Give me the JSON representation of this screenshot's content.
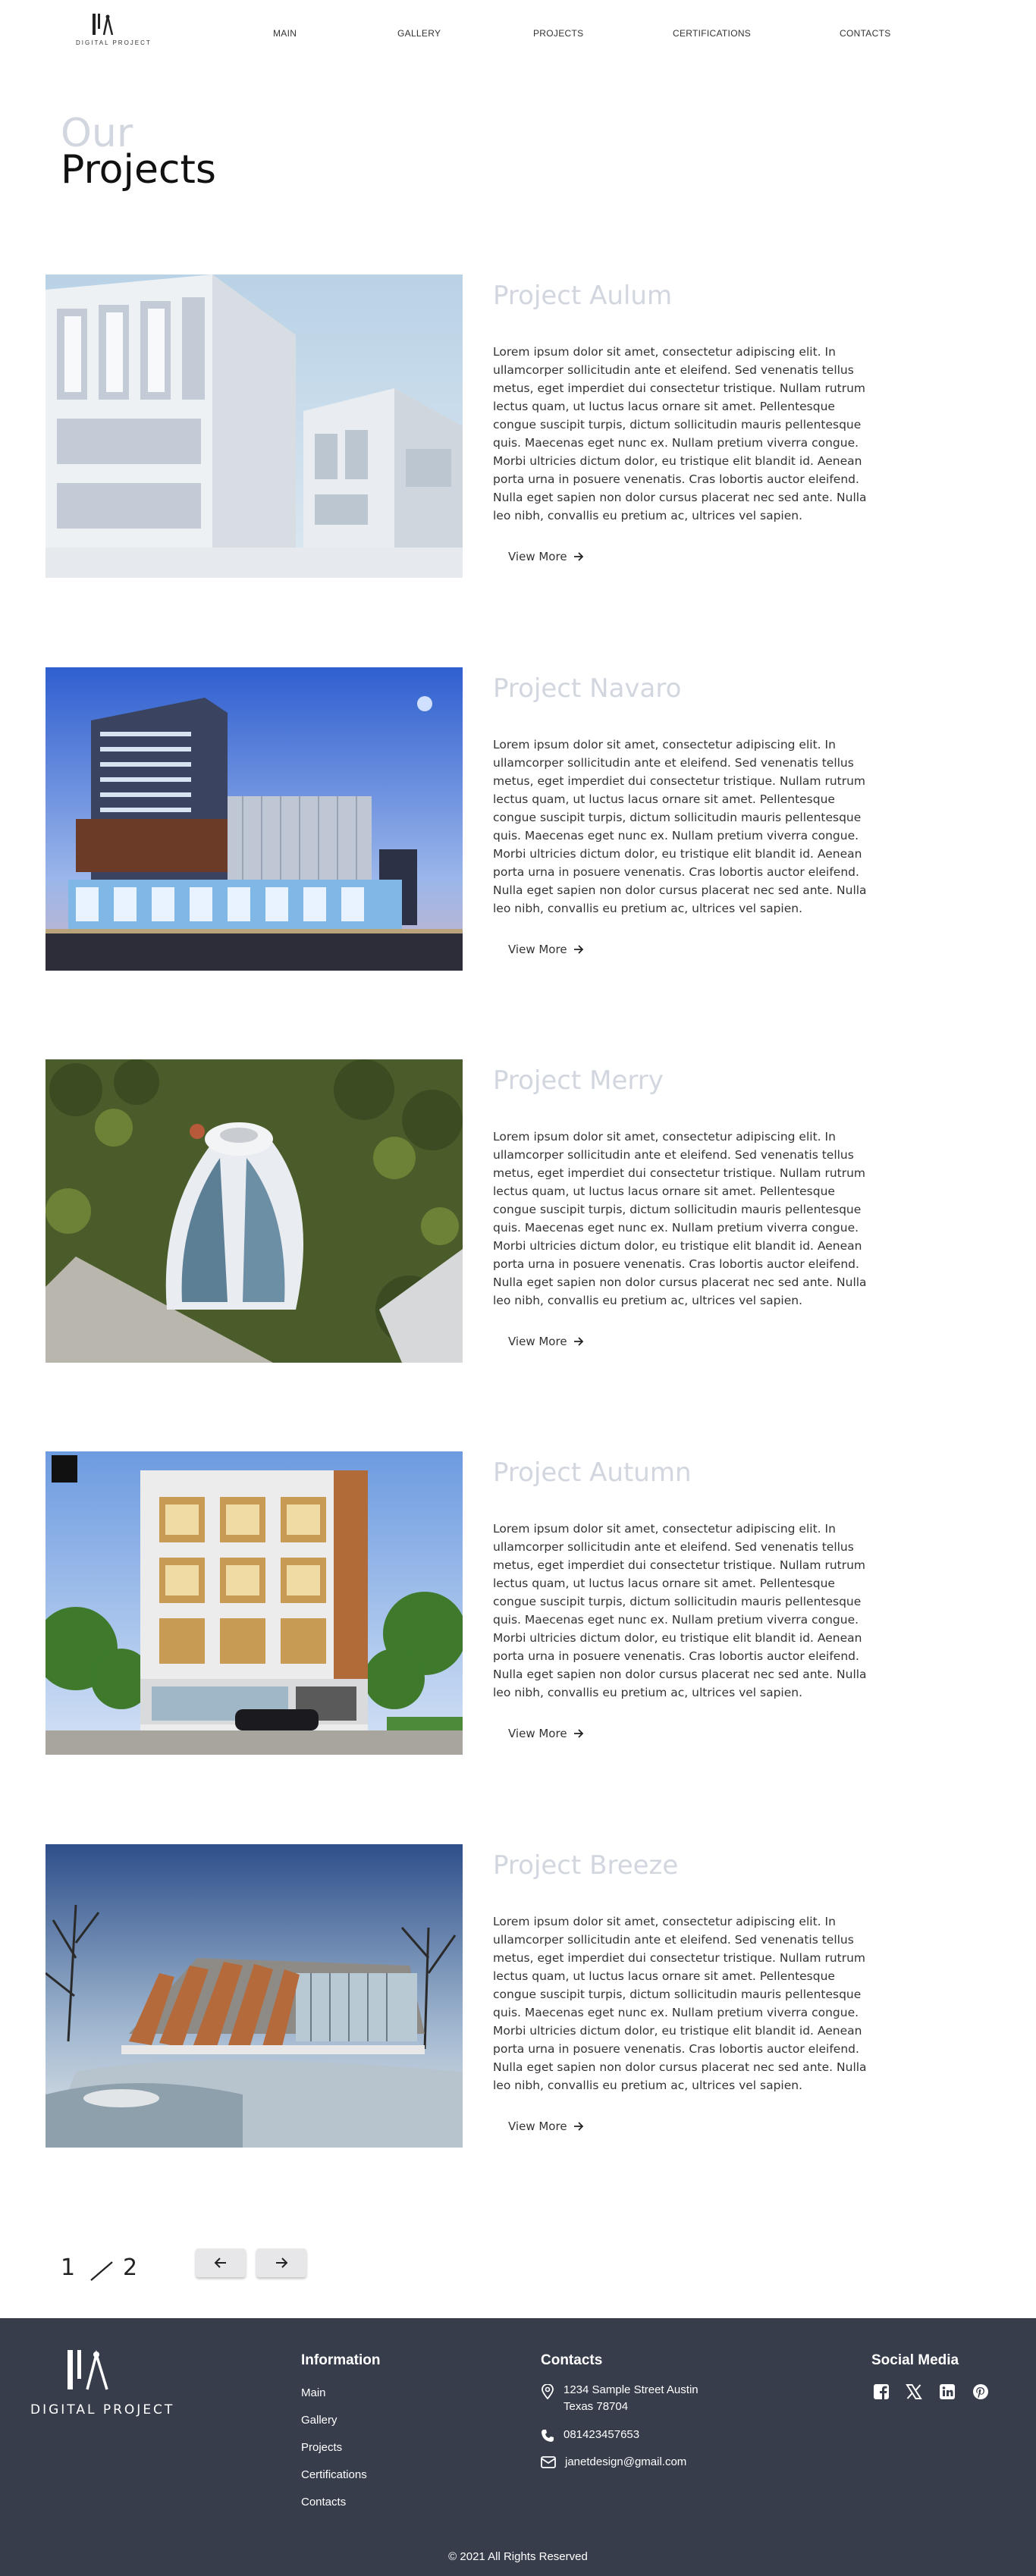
{
  "header": {
    "logo_text": "DIGITAL PROJECT",
    "nav": [
      "MAIN",
      "GALLERY",
      "PROJECTS",
      "CERTIFICATIONS",
      "CONTACTS"
    ]
  },
  "heading": {
    "line1": "Our",
    "line2": "Projects"
  },
  "projects": [
    {
      "title": "Project Aulum",
      "description": "Lorem ipsum dolor sit amet, consectetur adipiscing elit. In ullamcorper sollicitudin ante et eleifend. Sed venenatis tellus metus, eget imperdiet dui consectetur tristique. Nullam rutrum lectus quam, ut luctus lacus ornare sit amet. Pellentesque congue suscipit turpis, dictum sollicitudin mauris pellentesque quis. Maecenas eget nunc ex. Nullam pretium viverra congue. Morbi ultricies dictum dolor, eu tristique elit blandit id. Aenean porta urna in posuere venenatis. Cras lobortis auctor eleifend. Nulla eget sapien non dolor cursus placerat nec sed ante. Nulla leo nibh, convallis eu pretium ac, ultrices vel sapien.",
      "cta": "View More"
    },
    {
      "title": "Project Navaro",
      "description": "Lorem ipsum dolor sit amet, consectetur adipiscing elit. In ullamcorper sollicitudin ante et eleifend. Sed venenatis tellus metus, eget imperdiet dui consectetur tristique. Nullam rutrum lectus quam, ut luctus lacus ornare sit amet. Pellentesque congue suscipit turpis, dictum sollicitudin mauris pellentesque quis. Maecenas eget nunc ex. Nullam pretium viverra congue. Morbi ultricies dictum dolor, eu tristique elit blandit id. Aenean porta urna in posuere venenatis. Cras lobortis auctor eleifend. Nulla eget sapien non dolor cursus placerat nec sed ante. Nulla leo nibh, convallis eu pretium ac, ultrices vel sapien.",
      "cta": "View More"
    },
    {
      "title": "Project Merry",
      "description": "Lorem ipsum dolor sit amet, consectetur adipiscing elit. In ullamcorper sollicitudin ante et eleifend. Sed venenatis tellus metus, eget imperdiet dui consectetur tristique. Nullam rutrum lectus quam, ut luctus lacus ornare sit amet. Pellentesque congue suscipit turpis, dictum sollicitudin mauris pellentesque quis. Maecenas eget nunc ex. Nullam pretium viverra congue. Morbi ultricies dictum dolor, eu tristique elit blandit id. Aenean porta urna in posuere venenatis. Cras lobortis auctor eleifend. Nulla eget sapien non dolor cursus placerat nec sed ante. Nulla leo nibh, convallis eu pretium ac, ultrices vel sapien.",
      "cta": "View More"
    },
    {
      "title": "Project Autumn",
      "description": "Lorem ipsum dolor sit amet, consectetur adipiscing elit. In ullamcorper sollicitudin ante et eleifend. Sed venenatis tellus metus, eget imperdiet dui consectetur tristique. Nullam rutrum lectus quam, ut luctus lacus ornare sit amet. Pellentesque congue suscipit turpis, dictum sollicitudin mauris pellentesque quis. Maecenas eget nunc ex. Nullam pretium viverra congue. Morbi ultricies dictum dolor, eu tristique elit blandit id. Aenean porta urna in posuere venenatis. Cras lobortis auctor eleifend. Nulla eget sapien non dolor cursus placerat nec sed ante. Nulla leo nibh, convallis eu pretium ac, ultrices vel sapien.",
      "cta": "View More"
    },
    {
      "title": "Project Breeze",
      "description": "Lorem ipsum dolor sit amet, consectetur adipiscing elit. In ullamcorper sollicitudin ante et eleifend. Sed venenatis tellus metus, eget imperdiet dui consectetur tristique. Nullam rutrum lectus quam, ut luctus lacus ornare sit amet. Pellentesque congue suscipit turpis, dictum sollicitudin mauris pellentesque quis. Maecenas eget nunc ex. Nullam pretium viverra congue. Morbi ultricies dictum dolor, eu tristique elit blandit id. Aenean porta urna in posuere venenatis. Cras lobortis auctor eleifend. Nulla eget sapien non dolor cursus placerat nec sed ante. Nulla leo nibh, convallis eu pretium ac, ultrices vel sapien.",
      "cta": "View More"
    }
  ],
  "pagination": {
    "current": "1",
    "total": "2",
    "prev_icon": "arrow-left-icon",
    "next_icon": "arrow-right-icon"
  },
  "footer": {
    "logo_text": "DIGITAL PROJECT",
    "information": {
      "title": "Information",
      "links": [
        "Main",
        "Gallery",
        "Projects",
        "Certifications",
        "Contacts"
      ]
    },
    "contacts": {
      "title": "Contacts",
      "address_line1": "1234 Sample Street Austin",
      "address_line2": "Texas 78704",
      "phone": "081423457653",
      "email": "janetdesign@gmail.com"
    },
    "social": {
      "title": "Social Media",
      "icons": [
        "facebook-icon",
        "x-icon",
        "linkedin-icon",
        "pinterest-icon"
      ]
    },
    "copyright": "© 2021 All Rights Reserved"
  },
  "colors": {
    "footer_bg": "#373d4b",
    "muted_heading": "#d2d6df",
    "text": "#333333",
    "button_bg": "#e7e7ea"
  }
}
